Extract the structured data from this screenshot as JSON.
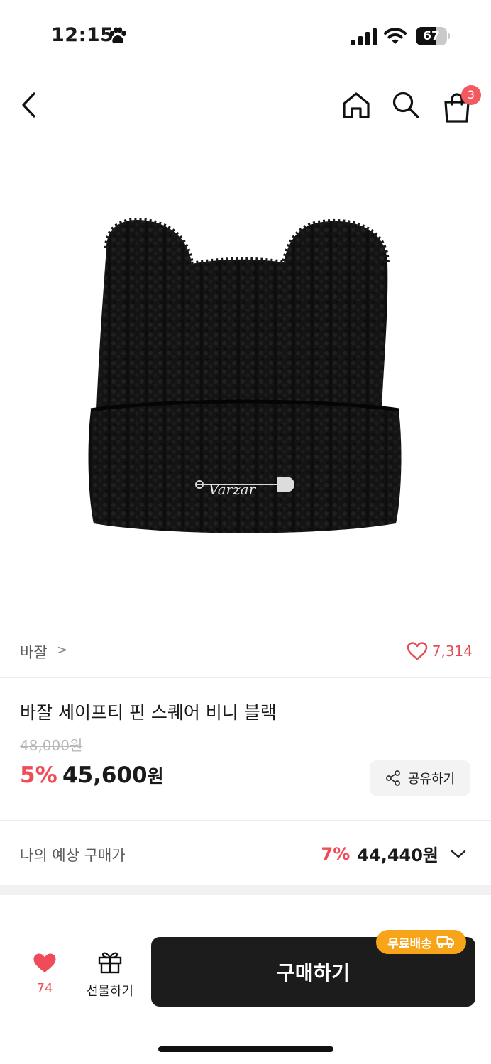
{
  "status_bar": {
    "time": "12:15",
    "battery": "67",
    "battery_level_percent": 67
  },
  "nav": {
    "cart_count": "3",
    "icons": [
      "chevron-left-icon",
      "home-icon",
      "search-icon",
      "shopping-bag-icon"
    ]
  },
  "product_image": {
    "logo_text": "Varzar"
  },
  "brand": {
    "name": "바잘",
    "chevron": ">",
    "like_count": "7,314"
  },
  "product": {
    "name": "바잘 세이프티 핀 스퀘어 비니 블랙",
    "original_price": "48,000원",
    "discount_rate": "5%",
    "sale_price_number": "45,600",
    "sale_price_unit": "원",
    "share_label": "공유하기"
  },
  "expected": {
    "label": "나의 예상 구매가",
    "rate": "7%",
    "price": "44,440원"
  },
  "bottom": {
    "wish_count": "74",
    "gift_label": "선물하기",
    "buy_label": "구매하기",
    "free_shipping_label": "무료배송"
  },
  "colors": {
    "accent_red": "#ef4c5a",
    "badge_red": "#f25a60",
    "shipping_orange": "#f7a418",
    "buy_dark": "#1c1c1c"
  }
}
